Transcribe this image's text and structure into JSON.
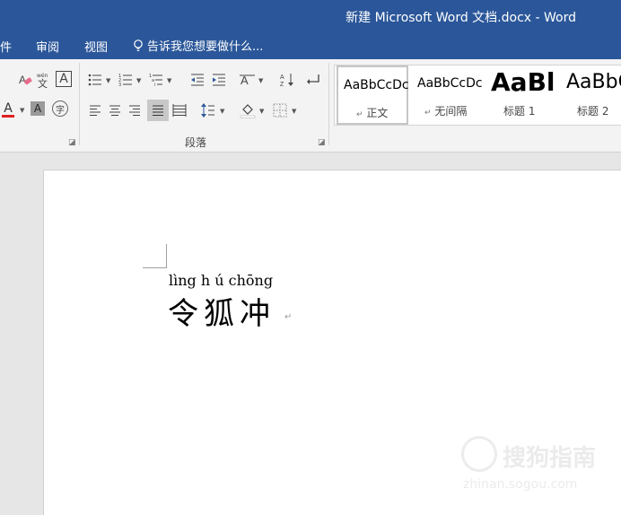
{
  "window": {
    "title": "新建 Microsoft Word 文档.docx - Word"
  },
  "menu": {
    "items": [
      "件",
      "审阅",
      "视图"
    ],
    "tell_me": "告诉我您想要做什么..."
  },
  "ribbon": {
    "font_group": {
      "phonetic_guide_icon": "wén 文",
      "char_border_icon": "A",
      "font_color_icon": "A",
      "char_shading_icon": "A",
      "enclosed_char_icon": "字"
    },
    "paragraph_group": {
      "label": "段落"
    },
    "styles": [
      {
        "sample": "AaBbCcDc",
        "name": "正文",
        "mark": "↵",
        "selected": true
      },
      {
        "sample": "AaBbCcDc",
        "name": "无间隔",
        "mark": "↵",
        "selected": false
      },
      {
        "sample": "AaBl",
        "name": "标题 1",
        "mark": "",
        "selected": false
      },
      {
        "sample": "AaBbC",
        "name": "标题 2",
        "mark": "",
        "selected": false
      }
    ]
  },
  "document": {
    "pinyin": "lìng h ú chōng",
    "text": "令狐冲",
    "paragraph_mark": "↵"
  },
  "watermark": {
    "name": "搜狗指南",
    "url": "zhinan.sogou.com"
  },
  "colors": {
    "title_bar": "#2b579a",
    "font_color_red": "#e02020",
    "ribbon_bg": "#f3f3f3"
  }
}
